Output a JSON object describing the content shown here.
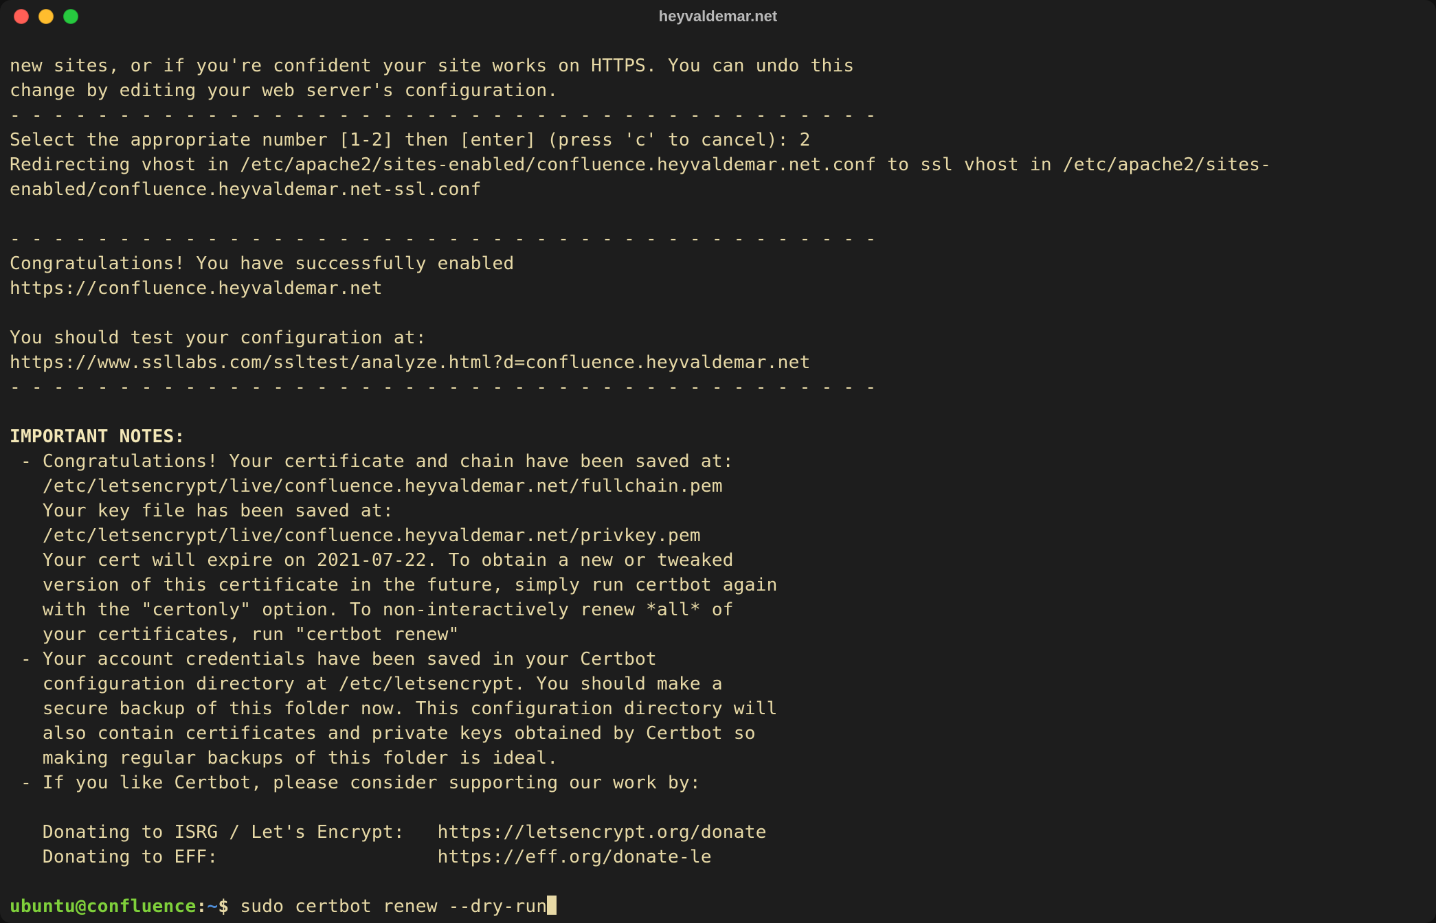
{
  "window": {
    "title": "heyvaldemar.net"
  },
  "terminal": {
    "lines": {
      "l0": "new sites, or if you're confident your site works on HTTPS. You can undo this",
      "l1": "change by editing your web server's configuration.",
      "l2": "- - - - - - - - - - - - - - - - - - - - - - - - - - - - - - - - - - - - - - - -",
      "l3": "Select the appropriate number [1-2] then [enter] (press 'c' to cancel): 2",
      "l4": "Redirecting vhost in /etc/apache2/sites-enabled/confluence.heyvaldemar.net.conf to ssl vhost in /etc/apache2/sites-",
      "l5": "enabled/confluence.heyvaldemar.net-ssl.conf",
      "l6": "",
      "l7": "- - - - - - - - - - - - - - - - - - - - - - - - - - - - - - - - - - - - - - - -",
      "l8": "Congratulations! You have successfully enabled",
      "l9": "https://confluence.heyvaldemar.net",
      "l10": "",
      "l11": "You should test your configuration at:",
      "l12": "https://www.ssllabs.com/ssltest/analyze.html?d=confluence.heyvaldemar.net",
      "l13": "- - - - - - - - - - - - - - - - - - - - - - - - - - - - - - - - - - - - - - - -",
      "l14": "",
      "l15": "IMPORTANT NOTES:",
      "l16": " - Congratulations! Your certificate and chain have been saved at:",
      "l17": "   /etc/letsencrypt/live/confluence.heyvaldemar.net/fullchain.pem",
      "l18": "   Your key file has been saved at:",
      "l19": "   /etc/letsencrypt/live/confluence.heyvaldemar.net/privkey.pem",
      "l20": "   Your cert will expire on 2021-07-22. To obtain a new or tweaked",
      "l21": "   version of this certificate in the future, simply run certbot again",
      "l22": "   with the \"certonly\" option. To non-interactively renew *all* of",
      "l23": "   your certificates, run \"certbot renew\"",
      "l24": " - Your account credentials have been saved in your Certbot",
      "l25": "   configuration directory at /etc/letsencrypt. You should make a",
      "l26": "   secure backup of this folder now. This configuration directory will",
      "l27": "   also contain certificates and private keys obtained by Certbot so",
      "l28": "   making regular backups of this folder is ideal.",
      "l29": " - If you like Certbot, please consider supporting our work by:",
      "l30": "",
      "l31": "   Donating to ISRG / Let's Encrypt:   https://letsencrypt.org/donate",
      "l32": "   Donating to EFF:                    https://eff.org/donate-le",
      "l33": ""
    },
    "prompt": {
      "user_host": "ubuntu@confluence",
      "separator": ":",
      "path": "~",
      "symbol": "$ ",
      "command": "sudo certbot renew --dry-run"
    }
  }
}
